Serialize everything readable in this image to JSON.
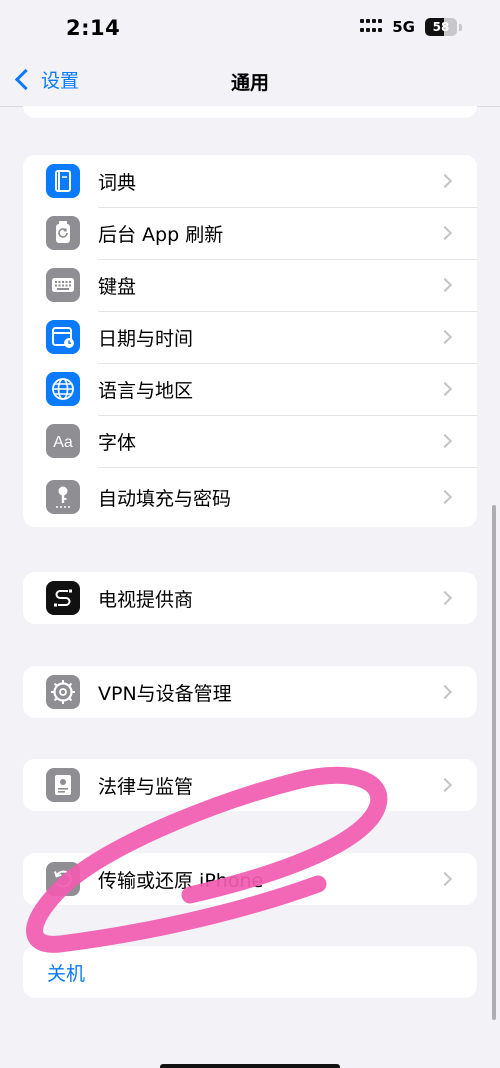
{
  "status_bar": {
    "time": "2:14",
    "network": "5G",
    "battery": "58",
    "battery_fraction": 0.58
  },
  "nav": {
    "back_label": "设置",
    "title": "通用"
  },
  "groups": [
    {
      "rows": [
        {
          "label": "词典",
          "icon": "dictionary-icon",
          "icon_bg": "#0a7aff"
        },
        {
          "label": "后台 App 刷新",
          "icon": "background-refresh-icon",
          "icon_bg": "#8e8e93"
        },
        {
          "label": "键盘",
          "icon": "keyboard-icon",
          "icon_bg": "#8e8e93"
        },
        {
          "label": "日期与时间",
          "icon": "calendar-clock-icon",
          "icon_bg": "#0a7aff"
        },
        {
          "label": "语言与地区",
          "icon": "globe-icon",
          "icon_bg": "#0a7aff"
        },
        {
          "label": "字体",
          "icon": "font-icon",
          "icon_bg": "#8e8e93"
        },
        {
          "label": "自动填充与密码",
          "icon": "key-icon",
          "icon_bg": "#8e8e93"
        }
      ]
    },
    {
      "rows": [
        {
          "label": "电视提供商",
          "icon": "tv-provider-icon",
          "icon_bg": "#111111"
        }
      ]
    },
    {
      "rows": [
        {
          "label": "VPN与设备管理",
          "icon": "gear-icon",
          "icon_bg": "#8e8e93"
        }
      ]
    },
    {
      "rows": [
        {
          "label": "法律与监管",
          "icon": "document-icon",
          "icon_bg": "#8e8e93"
        }
      ]
    },
    {
      "rows": [
        {
          "label": "传输或还原 iPhone",
          "icon": "reset-icon",
          "icon_bg": "#8e8e93"
        }
      ]
    }
  ],
  "shutdown": {
    "label": "关机"
  },
  "colors": {
    "accent": "#0a7aff",
    "background": "#f2f2f7",
    "annotation_scribble": "#f25cb0"
  }
}
